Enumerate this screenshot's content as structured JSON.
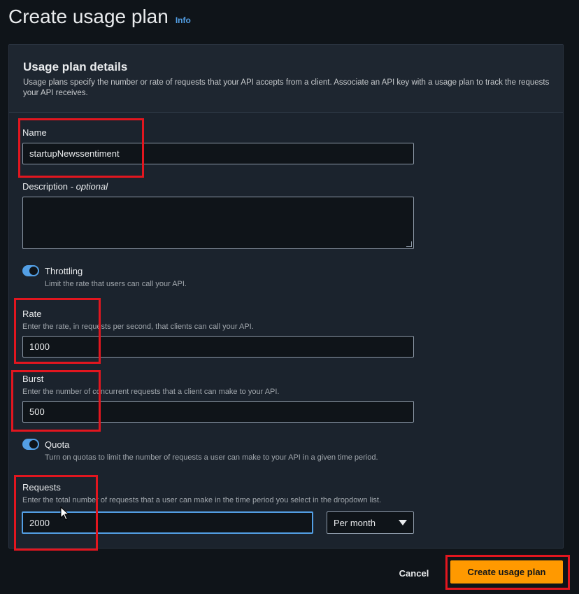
{
  "page": {
    "title": "Create usage plan",
    "info_link": "Info"
  },
  "panel": {
    "title": "Usage plan details",
    "description": "Usage plans specify the number or rate of requests that your API accepts from a client. Associate an API key with a usage plan to track the requests your API receives."
  },
  "form": {
    "name": {
      "label": "Name",
      "value": "startupNewssentiment"
    },
    "description": {
      "label": "Description",
      "optional_suffix": "- optional",
      "value": ""
    },
    "throttling": {
      "label": "Throttling",
      "hint": "Limit the rate that users can call your API.",
      "enabled": true
    },
    "rate": {
      "label": "Rate",
      "hint": "Enter the rate, in requests per second, that clients can call your API.",
      "value": "1000"
    },
    "burst": {
      "label": "Burst",
      "hint": "Enter the number of concurrent requests that a client can make to your API.",
      "value": "500"
    },
    "quota": {
      "label": "Quota",
      "hint": "Turn on quotas to limit the number of requests a user can make to your API in a given time period.",
      "enabled": true
    },
    "requests": {
      "label": "Requests",
      "hint": "Enter the total number of requests that a user can make in the time period you select in the dropdown list.",
      "value": "2000",
      "period": "Per month"
    }
  },
  "actions": {
    "cancel": "Cancel",
    "create": "Create usage plan"
  },
  "colors": {
    "accent": "#539fe5",
    "primary_button": "#ff9900",
    "highlight": "#e2161f"
  }
}
